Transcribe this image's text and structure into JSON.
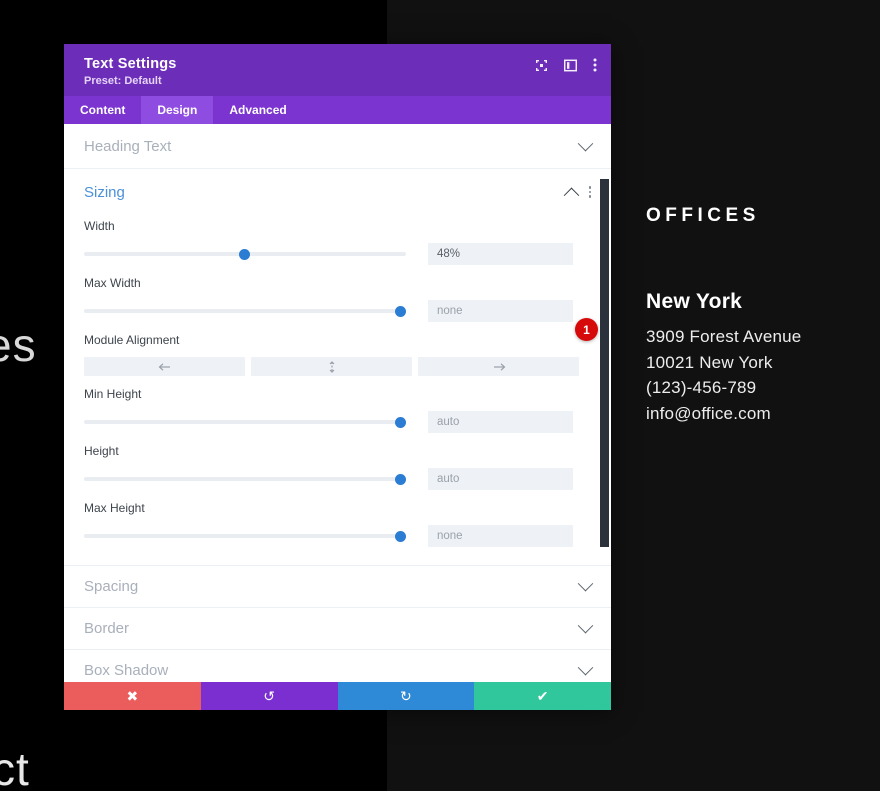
{
  "background": {
    "partial_text_left": "es",
    "partial_text_bottom": "ct",
    "offices": {
      "heading": "OFFICES",
      "city": "New York",
      "address_lines": [
        "3909 Forest Avenue",
        "10021 New York",
        "(123)-456-789",
        "info@office.com"
      ]
    }
  },
  "modal": {
    "title": "Text Settings",
    "preset": "Preset: Default",
    "header_icons": [
      {
        "name": "focus-target-icon"
      },
      {
        "name": "panel-layout-icon"
      },
      {
        "name": "more-vertical-icon"
      }
    ],
    "tabs": [
      {
        "label": "Content",
        "active": false
      },
      {
        "label": "Design",
        "active": true
      },
      {
        "label": "Advanced",
        "active": false
      }
    ],
    "sections": [
      {
        "label": "Heading Text",
        "open": false
      },
      {
        "label": "Sizing",
        "open": true
      },
      {
        "label": "Spacing",
        "open": false
      },
      {
        "label": "Border",
        "open": false
      },
      {
        "label": "Box Shadow",
        "open": false
      }
    ],
    "sizing": {
      "fields": [
        {
          "label": "Width",
          "value": "48%",
          "is_placeholder": false,
          "knob_pct": 48
        },
        {
          "label": "Max Width",
          "value": "none",
          "is_placeholder": true,
          "knob_pct": 98
        },
        {
          "label": "Min Height",
          "value": "auto",
          "is_placeholder": true,
          "knob_pct": 98
        },
        {
          "label": "Height",
          "value": "auto",
          "is_placeholder": true,
          "knob_pct": 98
        },
        {
          "label": "Max Height",
          "value": "none",
          "is_placeholder": true,
          "knob_pct": 98
        }
      ],
      "module_alignment": {
        "label": "Module Alignment",
        "options": [
          {
            "name": "align-left",
            "glyph": "←"
          },
          {
            "name": "align-center",
            "glyph": "↕"
          },
          {
            "name": "align-right",
            "glyph": "→"
          }
        ]
      },
      "badge": "1"
    },
    "footer": [
      {
        "name": "cancel-button",
        "glyph": "✖",
        "class": "cancel"
      },
      {
        "name": "undo-button",
        "glyph": "↺",
        "class": "undo"
      },
      {
        "name": "redo-button",
        "glyph": "↻",
        "class": "redo"
      },
      {
        "name": "save-button",
        "glyph": "✔",
        "class": "save"
      }
    ]
  },
  "colors": {
    "header_purple": "#6c2eb9",
    "tabbar_purple": "#7b34cf",
    "tab_active": "#8f4ce0",
    "slider_blue": "#2b7cd3",
    "badge_red": "#d60a0a",
    "accent_open": "#4c90d8"
  }
}
